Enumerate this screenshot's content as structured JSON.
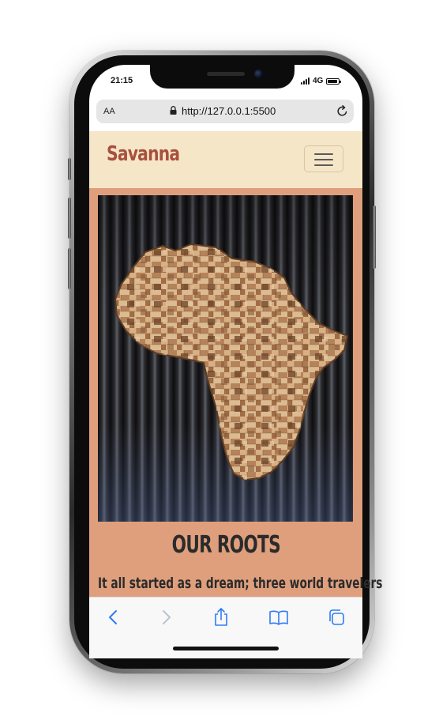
{
  "status_bar": {
    "time": "21:15",
    "network": "4G",
    "battery_level": 0.9
  },
  "browser": {
    "text_size_label": "AA",
    "url": "http://127.0.0.1:5500"
  },
  "site": {
    "brand": "Savanna",
    "section_title": "OUR ROOTS",
    "section_text": "It all started as a dream; three world travelers"
  },
  "colors": {
    "brand": "#a8503e",
    "navbar_bg": "#f6e6c8",
    "section_bg": "#df9f7d",
    "text_dark": "#2b2b2b",
    "ios_blue": "#2f7cf6"
  },
  "icons": [
    "lock-icon",
    "reload-icon",
    "hamburger-icon",
    "back-icon",
    "forward-icon",
    "share-icon",
    "bookmarks-icon",
    "tabs-icon"
  ]
}
